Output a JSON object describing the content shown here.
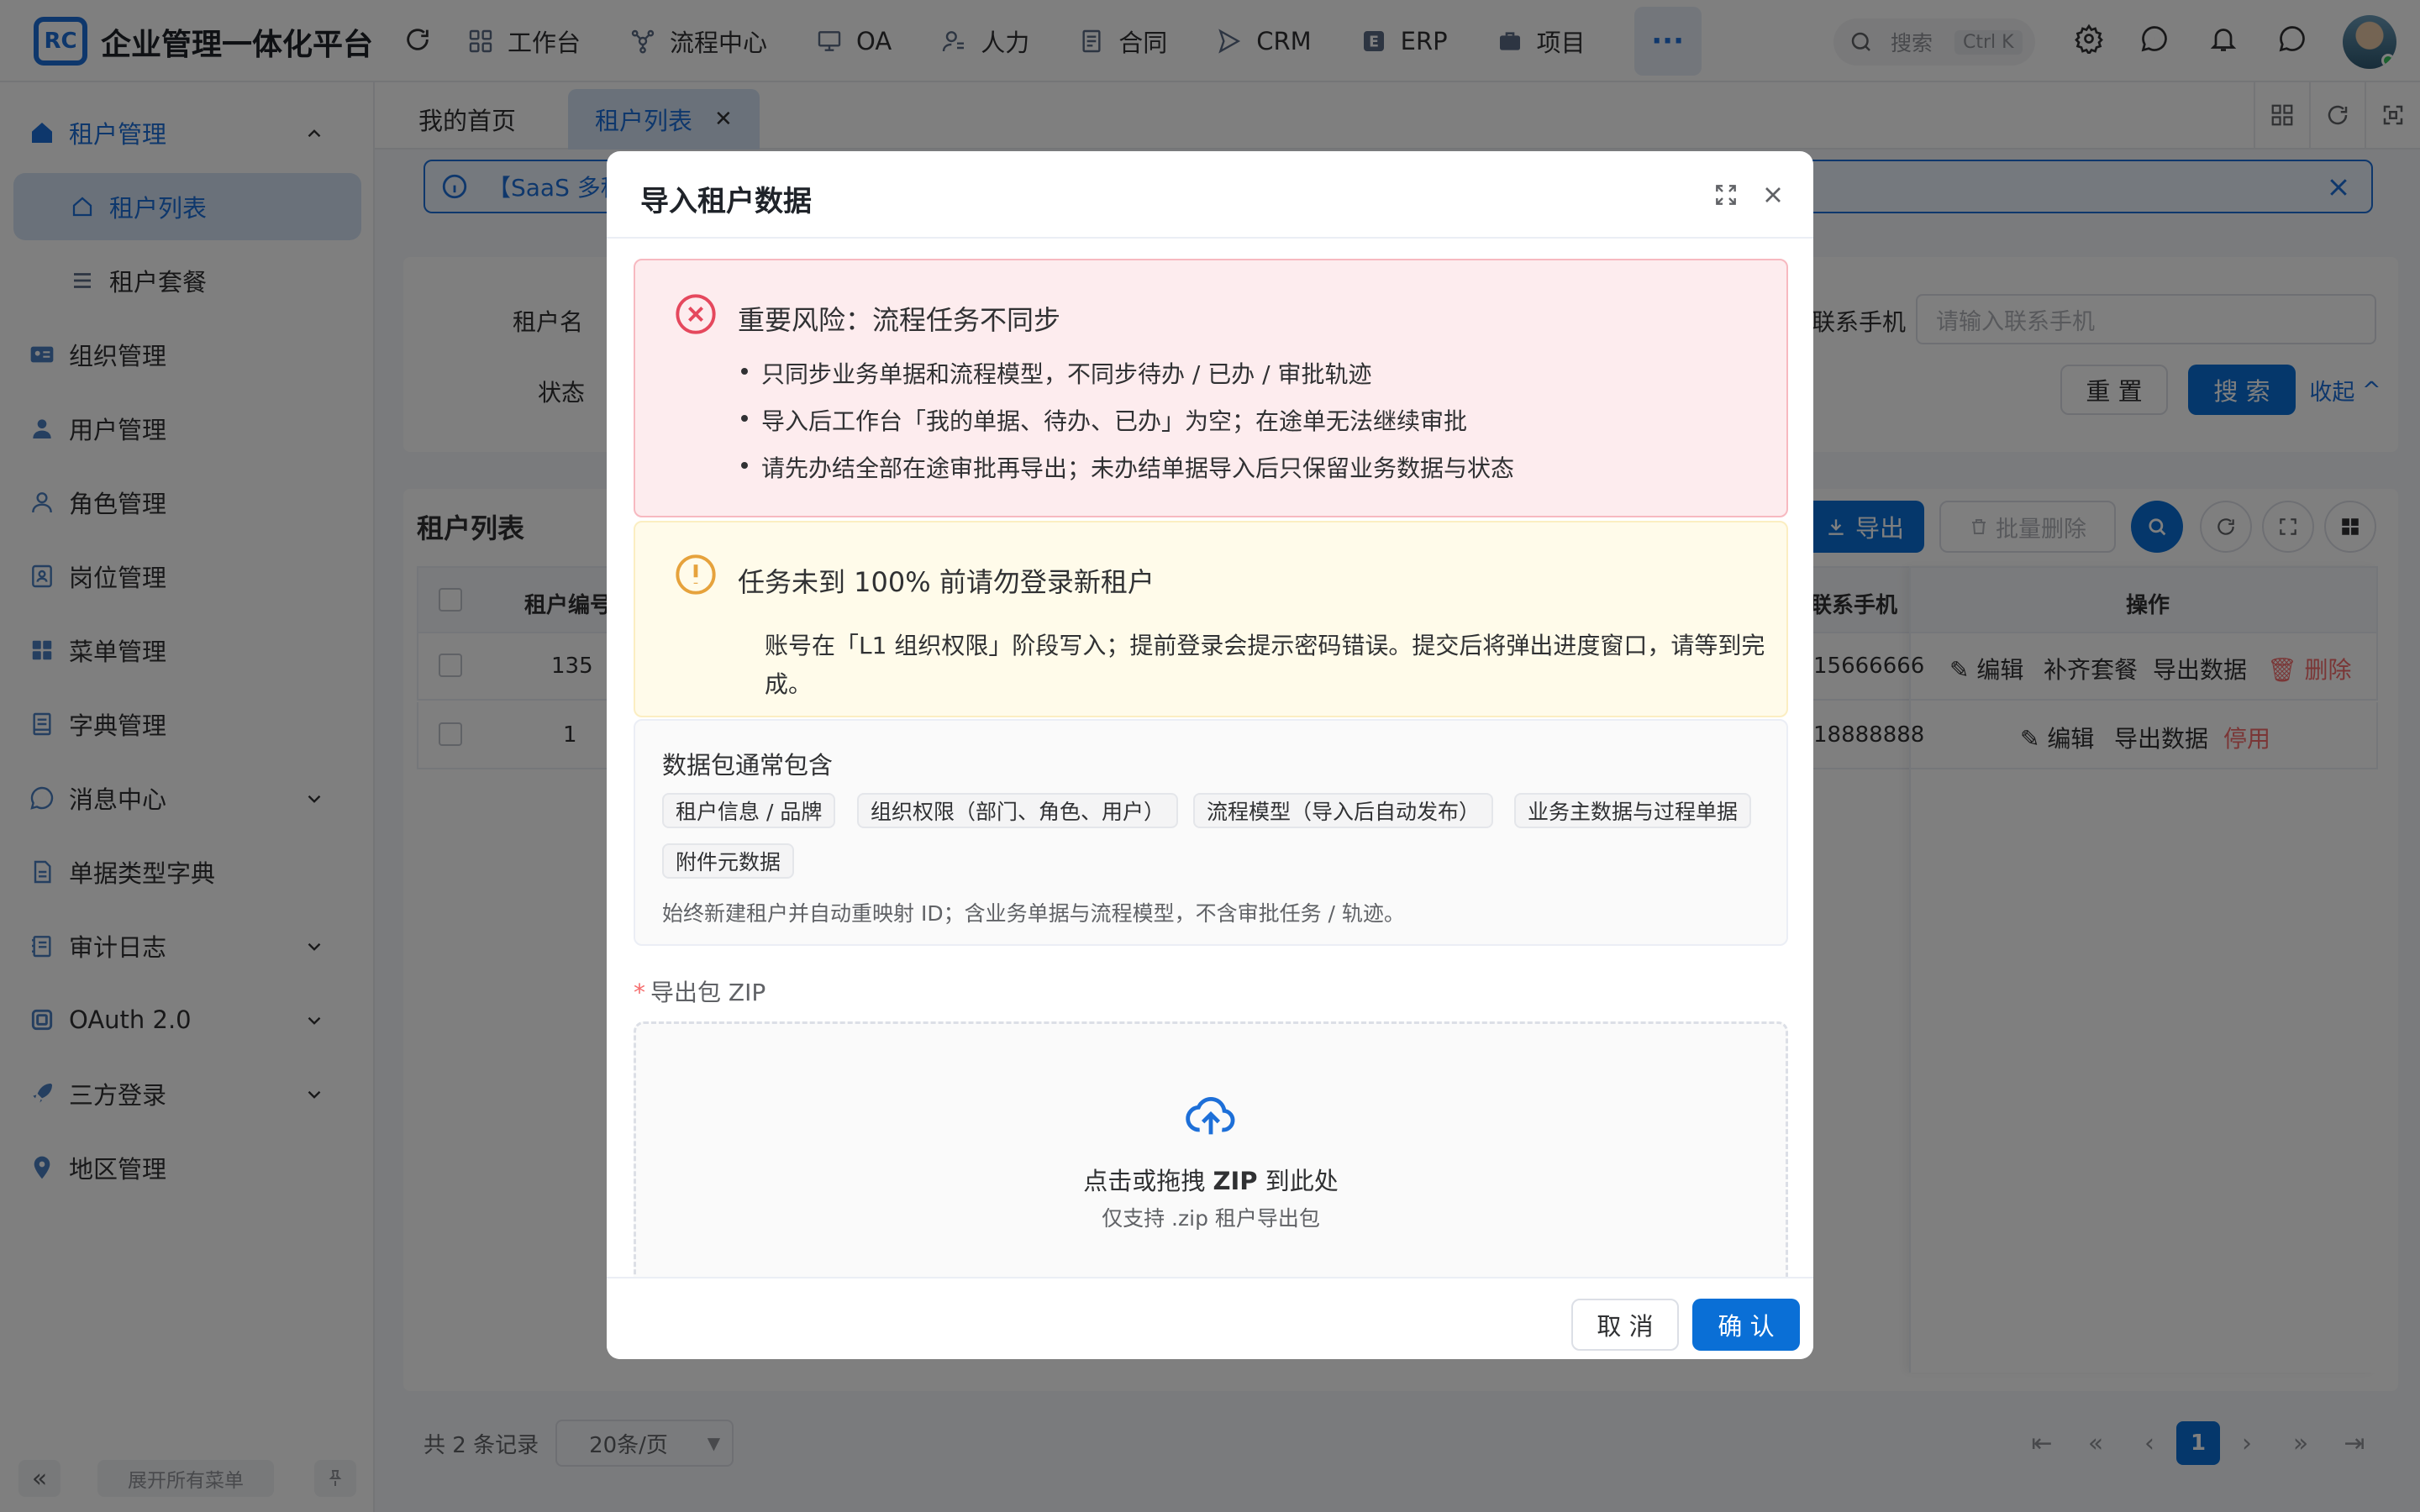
{
  "header": {
    "logo_text": "RC",
    "app_title": "企业管理一体化平台",
    "nav": [
      {
        "label": "工作台",
        "icon": "grid-icon"
      },
      {
        "label": "流程中心",
        "icon": "workflow-icon"
      },
      {
        "label": "OA",
        "icon": "monitor-icon"
      },
      {
        "label": "人力",
        "icon": "person-icon"
      },
      {
        "label": "合同",
        "icon": "document-icon"
      },
      {
        "label": "CRM",
        "icon": "send-icon"
      },
      {
        "label": "ERP",
        "icon": "erp-icon"
      },
      {
        "label": "项目",
        "icon": "briefcase-icon"
      }
    ],
    "more_label": "···",
    "search_placeholder": "搜索",
    "search_shortcut": "Ctrl K"
  },
  "sidebar": {
    "items": [
      {
        "label": "租户管理",
        "icon": "home-icon",
        "expanded": true
      },
      {
        "label": "租户列表",
        "icon": "house-outline-icon"
      },
      {
        "label": "租户套餐",
        "icon": "list-icon"
      },
      {
        "label": "组织管理",
        "icon": "id-card-icon"
      },
      {
        "label": "用户管理",
        "icon": "user-icon"
      },
      {
        "label": "角色管理",
        "icon": "user-outline-icon"
      },
      {
        "label": "岗位管理",
        "icon": "badge-icon"
      },
      {
        "label": "菜单管理",
        "icon": "apps-icon"
      },
      {
        "label": "字典管理",
        "icon": "book-icon"
      },
      {
        "label": "消息中心",
        "icon": "chat-icon"
      },
      {
        "label": "单据类型字典",
        "icon": "file-icon"
      },
      {
        "label": "审计日志",
        "icon": "log-icon"
      },
      {
        "label": "OAuth 2.0",
        "icon": "oauth-icon"
      },
      {
        "label": "三方登录",
        "icon": "rocket-icon"
      },
      {
        "label": "地区管理",
        "icon": "location-icon"
      }
    ],
    "footer": {
      "expand_all": "展开所有菜单"
    }
  },
  "tabs": [
    {
      "label": "我的首页"
    },
    {
      "label": "租户列表",
      "active": true
    }
  ],
  "notice": {
    "text": "【SaaS 多租"
  },
  "search_form": {
    "tenant_name_label": "租户名",
    "status_label": "状态",
    "phone_label": "联系手机",
    "phone_placeholder": "请输入联系手机",
    "reset_label": "重 置",
    "search_label": "搜 索",
    "collapse_label": "收起"
  },
  "table": {
    "title": "租户列表",
    "export_label": "导出",
    "batch_delete_label": "批量删除",
    "columns": {
      "id": "租户编号",
      "phone": "联系手机",
      "ops": "操作"
    },
    "rows": [
      {
        "id": "135",
        "phone": "15666666",
        "ops": [
          "编辑",
          "补齐套餐",
          "导出数据",
          "删除"
        ]
      },
      {
        "id": "1",
        "phone": "18888888",
        "ops": [
          "编辑",
          "导出数据",
          "停用"
        ]
      }
    ],
    "total_text": "共 2 条记录",
    "page_size": "20条/页",
    "current_page": "1"
  },
  "modal": {
    "title": "导入租户数据",
    "error_alert": {
      "title": "重要风险：流程任务不同步",
      "bullets": [
        "只同步业务单据和流程模型，不同步待办 / 已办 / 审批轨迹",
        "导入后工作台「我的单据、待办、已办」为空；在途单无法继续审批",
        "请先办结全部在途审批再导出；未办结单据导入后只保留业务数据与状态"
      ]
    },
    "warning_alert": {
      "title": "任务未到 100% 前请勿登录新租户",
      "body": "账号在「L1 组织权限」阶段写入；提前登录会提示密码错误。提交后将弹出进度窗口，请等到完成。"
    },
    "package": {
      "title": "数据包通常包含",
      "chips": [
        "租户信息 / 品牌",
        "组织权限（部门、角色、用户）",
        "流程模型（导入后自动发布）",
        "业务主数据与过程单据",
        "附件元数据"
      ],
      "note": "始终新建租户并自动重映射 ID；含业务单据与流程模型，不含审批任务 / 轨迹。"
    },
    "zip_label": "导出包 ZIP",
    "dropzone": {
      "main_prefix": "点击或拖拽 ",
      "main_bold": "ZIP",
      "main_suffix": " 到此处",
      "sub": "仅支持 .zip 租户导出包"
    },
    "cancel_label": "取 消",
    "confirm_label": "确 认"
  },
  "colors": {
    "primary": "#0a6fd6",
    "danger": "#f56c6c",
    "warning": "#e6a23c"
  }
}
